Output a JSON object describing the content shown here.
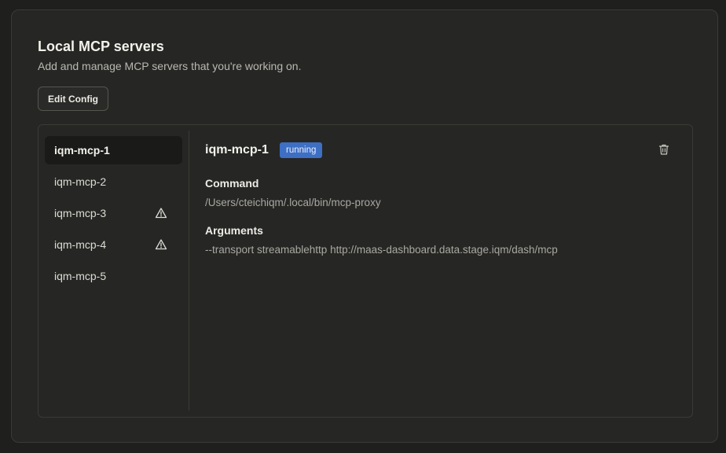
{
  "page": {
    "title": "Local MCP servers",
    "subtitle": "Add and manage MCP servers that you're working on.",
    "edit_config_label": "Edit Config"
  },
  "sidebar": {
    "items": [
      {
        "label": "iqm-mcp-1",
        "active": true,
        "warning": false
      },
      {
        "label": "iqm-mcp-2",
        "active": false,
        "warning": false
      },
      {
        "label": "iqm-mcp-3",
        "active": false,
        "warning": true
      },
      {
        "label": "iqm-mcp-4",
        "active": false,
        "warning": true
      },
      {
        "label": "iqm-mcp-5",
        "active": false,
        "warning": false
      }
    ]
  },
  "detail": {
    "name": "iqm-mcp-1",
    "status": "running",
    "command_label": "Command",
    "command_value": "/Users/cteichiqm/.local/bin/mcp-proxy",
    "arguments_label": "Arguments",
    "arguments_value": "--transport streamablehttp http://maas-dashboard.data.stage.iqm/dash/mcp"
  },
  "colors": {
    "status_badge": "#3d6fc4",
    "background": "#262624"
  },
  "icons": {
    "warning": "warning-triangle-icon",
    "delete": "trash-icon"
  }
}
